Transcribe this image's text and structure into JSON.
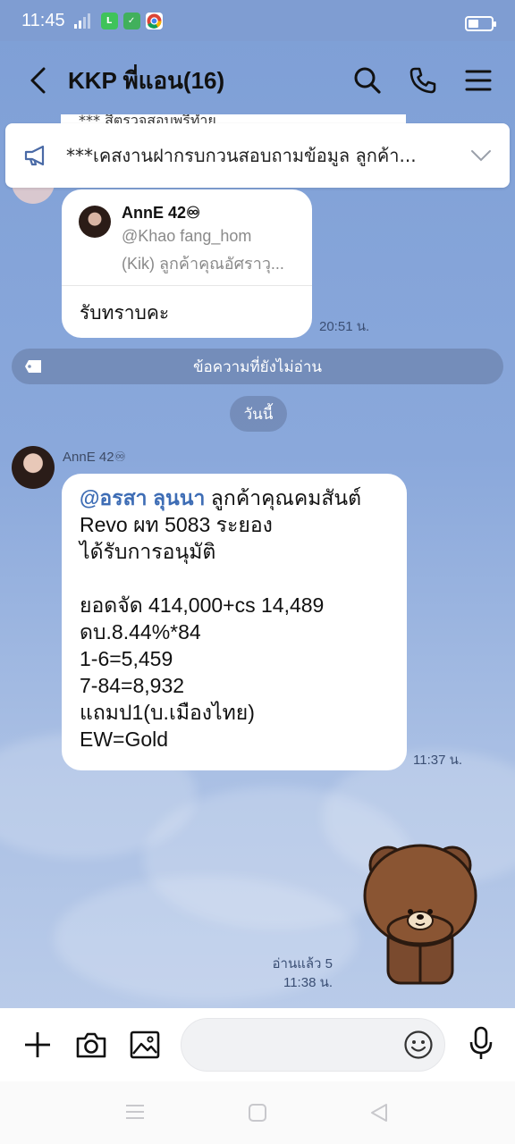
{
  "status_bar": {
    "time": "11:45",
    "network": "4G"
  },
  "header": {
    "title": "KKP พี่แอน(16)"
  },
  "announcement": {
    "peek_text": "*** สีตรวจสอบพรีทำย",
    "text": "***เคสงานฝากรบกวนสอบถามข้อมูล ลูกค้า..."
  },
  "reply_message": {
    "quote_name": "AnnE 42♾",
    "quote_line1": "@Khao fang_hom",
    "quote_line2": "(Kik) ลูกค้าคุณอัศราวุ...",
    "text": "รับทราบคะ",
    "time": "20:51 น."
  },
  "unread_divider": "ข้อความที่ยังไม่อ่าน",
  "date_divider": "วันนี้",
  "message": {
    "sender": "AnnE 42♾",
    "mention": "@อรสา ลุนนา",
    "line1_rest": " ลูกค้าคุณคมสันต์",
    "line2": "Revo ผท 5083 ระยอง",
    "line3": "ได้รับการอนุมัติ",
    "line4": "ยอดจัด 414,000+cs 14,489",
    "line5": "ดบ.8.44%*84",
    "line6": "1-6=5,459",
    "line7": "7-84=8,932",
    "line8": "แถมป1(บ.เมืองไทย)",
    "line9": "EW=Gold",
    "time": "11:37 น."
  },
  "sticker_message": {
    "read_label": "อ่านแล้ว 5",
    "time": "11:38 น."
  },
  "colors": {
    "accent": "#3e6db5",
    "chat_bg": "#8aa8db"
  }
}
